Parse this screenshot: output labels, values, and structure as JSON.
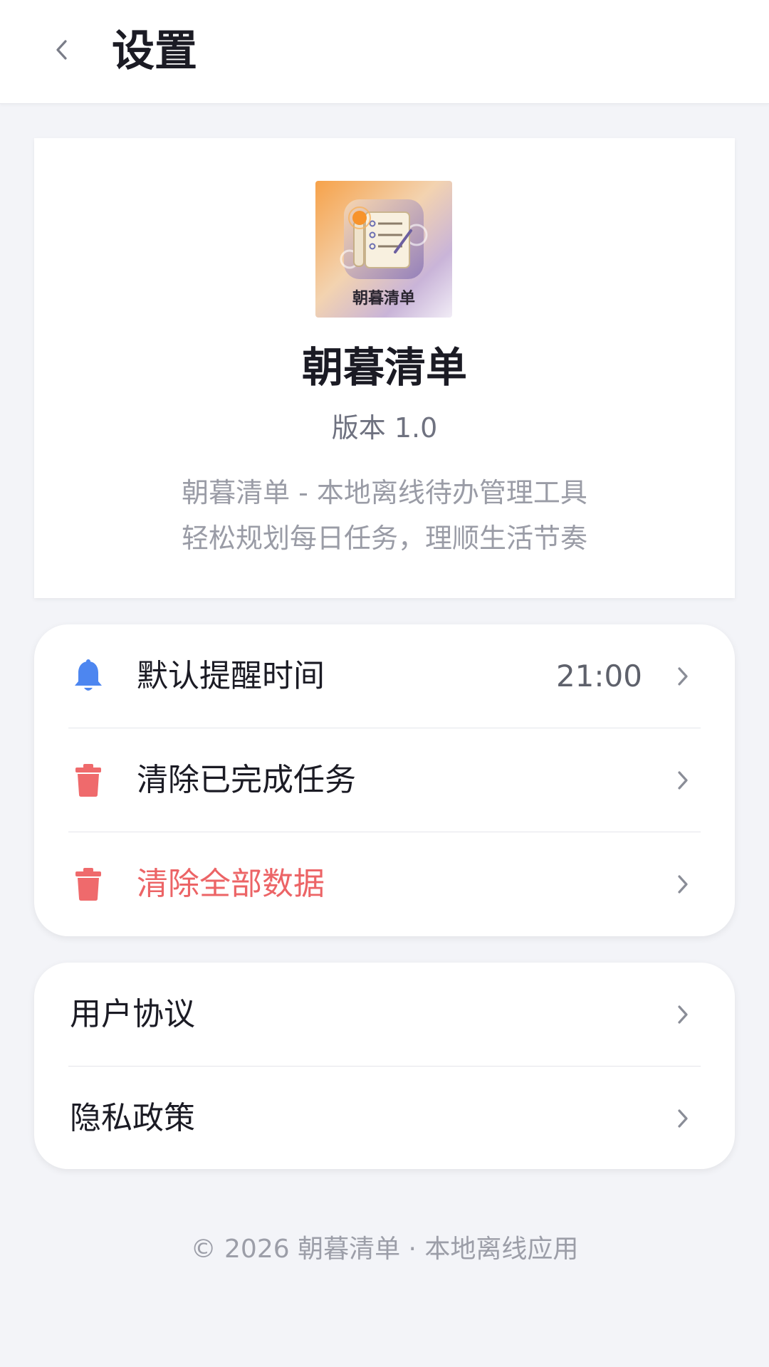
{
  "header": {
    "title": "设置",
    "back_icon": "chevron-left-icon"
  },
  "about": {
    "icon_label": "朝暮清单",
    "app_name": "朝暮清单",
    "version": "版本 1.0",
    "description_line1": "朝暮清单 - 本地离线待办管理工具",
    "description_line2": "轻松规划每日任务，理顺生活节奏"
  },
  "settings": {
    "reminder": {
      "label": "默认提醒时间",
      "value": "21:00",
      "icon": "bell-icon",
      "color": "#4d86f0"
    },
    "clear_completed": {
      "label": "清除已完成任务",
      "icon": "trash-icon",
      "color": "#ef6a6c"
    },
    "clear_all": {
      "label": "清除全部数据",
      "icon": "trash-icon",
      "color": "#ef6a6c"
    }
  },
  "legal": {
    "user_agreement": "用户协议",
    "privacy_policy": "隐私政策"
  },
  "footer": {
    "copyright": "© 2026 朝暮清单 · 本地离线应用"
  },
  "colors": {
    "background": "#f3f4f8",
    "card": "#ffffff",
    "danger": "#ec6466",
    "accent": "#4d86f0"
  }
}
